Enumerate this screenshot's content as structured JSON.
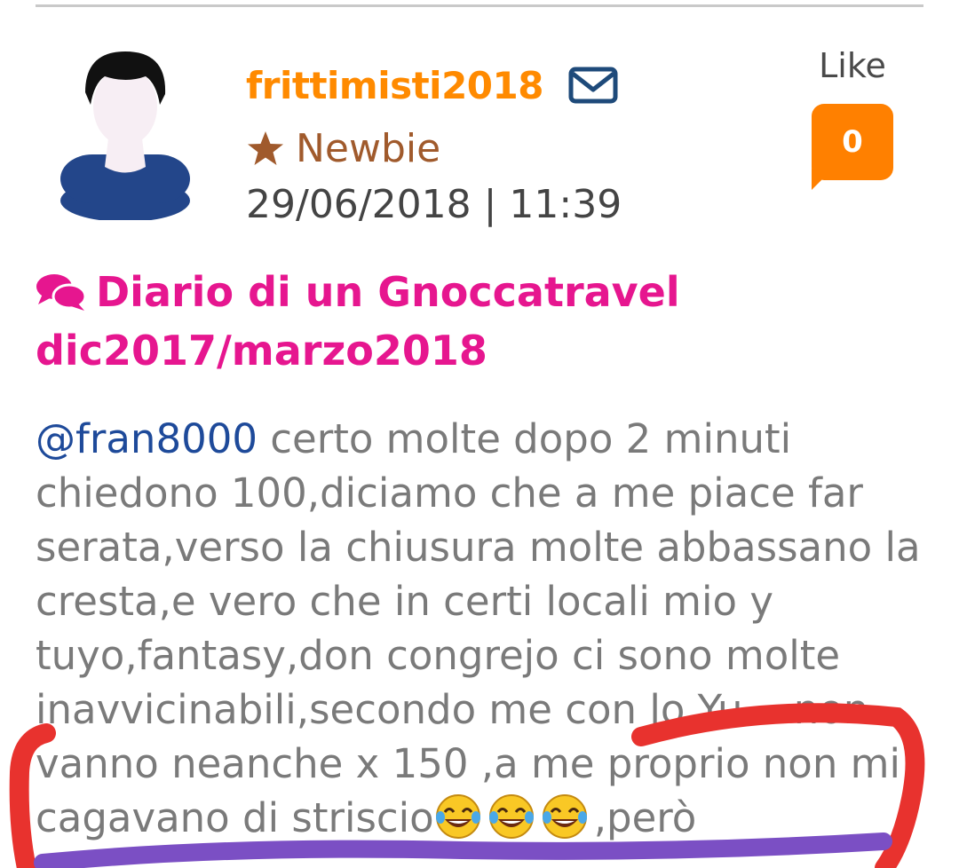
{
  "post": {
    "author": {
      "username": "frittimisti2018",
      "rank": "Newbie",
      "avatar_icon": "default-user-avatar-icon"
    },
    "date": "29/06/2018 | 11:39",
    "like": {
      "label": "Like",
      "count": "0"
    },
    "thread_title": "Diario di un Gnoccatravel dic2017/marzo2018",
    "body": {
      "mention": "@fran8000",
      "text": " certo molte dopo 2 minuti chiedono 100,diciamo che a me piace far serata,verso la chiusura molte abbassano la cresta,e vero che in certi locali mio y tuyo,fantasy,don congrejo ci sono molte inavvicinabili,secondo me con lo Yu... non vanno neanche x 150 ,a me proprio non mi cagavano di striscio",
      "emoji": [
        "tears-of-joy-emoji",
        "tears-of-joy-emoji",
        "tears-of-joy-emoji"
      ],
      "tail": ",però"
    }
  },
  "colors": {
    "username": "#ff8a00",
    "rank": "#a05a2c",
    "title": "#e6168f",
    "mention": "#1e4a9a",
    "like_badge": "#ff8000",
    "annotation_red": "#e8322e",
    "annotation_purple": "#7b4fc4"
  }
}
